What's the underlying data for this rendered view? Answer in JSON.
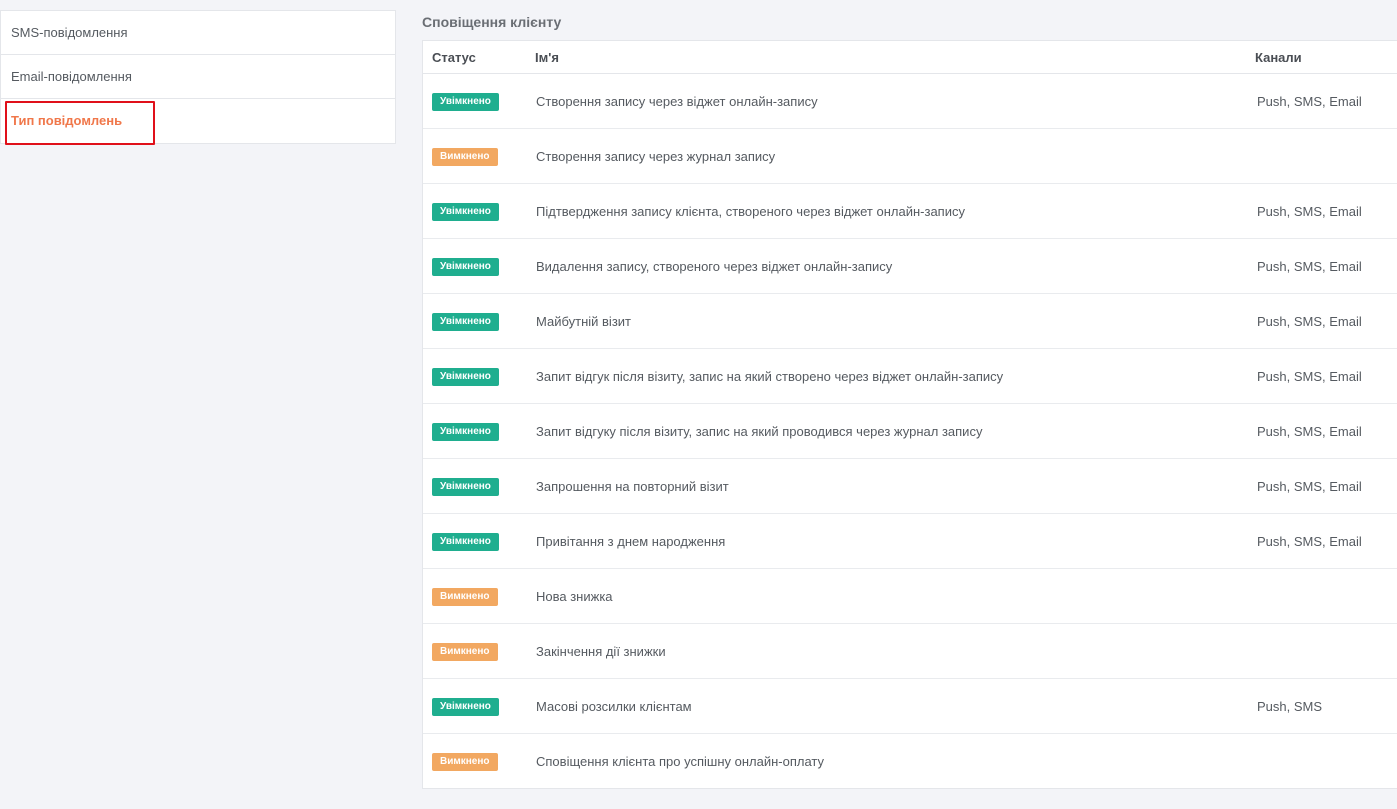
{
  "sidebar": {
    "items": [
      {
        "label": "SMS-повідомлення"
      },
      {
        "label": "Email-повідомлення"
      },
      {
        "label": "Тип повідомлень"
      }
    ]
  },
  "main": {
    "title": "Сповіщення клієнту",
    "columns": {
      "status": "Статус",
      "name": "Ім'я",
      "channels": "Канали"
    },
    "rows": [
      {
        "status": "Увімкнено",
        "enabled": true,
        "name": "Створення запису через віджет онлайн-запису",
        "channels": "Push, SMS, Email"
      },
      {
        "status": "Вимкнено",
        "enabled": false,
        "name": "Створення запису через журнал запису",
        "channels": ""
      },
      {
        "status": "Увімкнено",
        "enabled": true,
        "name": "Підтвердження запису клієнта, створеного через віджет онлайн-запису",
        "channels": "Push, SMS, Email"
      },
      {
        "status": "Увімкнено",
        "enabled": true,
        "name": "Видалення запису, створеного через віджет онлайн-запису",
        "channels": "Push, SMS, Email"
      },
      {
        "status": "Увімкнено",
        "enabled": true,
        "name": "Майбутній візит",
        "channels": "Push, SMS, Email"
      },
      {
        "status": "Увімкнено",
        "enabled": true,
        "name": "Запит відгук після візиту, запис на який створено через віджет онлайн-запису",
        "channels": "Push, SMS, Email"
      },
      {
        "status": "Увімкнено",
        "enabled": true,
        "name": "Запит відгуку після візиту, запис на який проводився через журнал запису",
        "channels": "Push, SMS, Email"
      },
      {
        "status": "Увімкнено",
        "enabled": true,
        "name": "Запрошення на повторний візит",
        "channels": "Push, SMS, Email"
      },
      {
        "status": "Увімкнено",
        "enabled": true,
        "name": "Привітання з днем народження",
        "channels": "Push, SMS, Email"
      },
      {
        "status": "Вимкнено",
        "enabled": false,
        "name": "Нова знижка",
        "channels": ""
      },
      {
        "status": "Вимкнено",
        "enabled": false,
        "name": "Закінчення дії знижки",
        "channels": ""
      },
      {
        "status": "Увімкнено",
        "enabled": true,
        "name": "Масові розсилки клієнтам",
        "channels": "Push, SMS"
      },
      {
        "status": "Вимкнено",
        "enabled": false,
        "name": "Сповіщення клієнта про успішну онлайн-оплату",
        "channels": ""
      }
    ]
  },
  "colors": {
    "enabled_badge": "#1fae8f",
    "disabled_badge": "#f2a861",
    "active_sidebar_text": "#f0774a",
    "highlight_border": "#e0101a"
  }
}
